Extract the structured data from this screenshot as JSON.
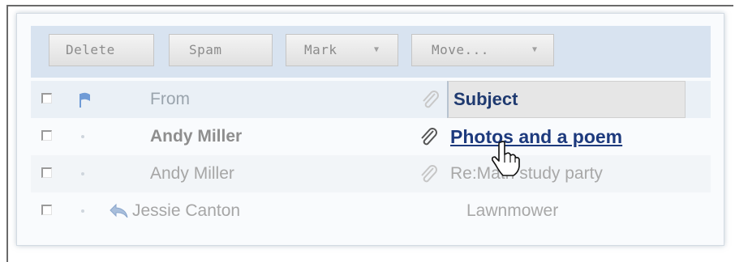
{
  "toolbar": {
    "buttons": [
      {
        "label": "Delete"
      },
      {
        "label": "Spam"
      },
      {
        "label": "Mark",
        "caret": "▼"
      },
      {
        "label": "Move...",
        "caret": "▼"
      }
    ]
  },
  "columns": {
    "from": "From",
    "subject": "Subject"
  },
  "messages": [
    {
      "from": "Andy Miller",
      "subject": "Photos and a poem",
      "unread": true,
      "attachment": true,
      "state": "hovered-link"
    },
    {
      "from": "Andy Miller",
      "subject": "Re:Math study party",
      "unread": false,
      "attachment": true
    },
    {
      "from": "Jessie Canton",
      "subject": "Lawnmower",
      "unread": false,
      "attachment": false,
      "replied": true
    }
  ],
  "icons": [
    "checkbox",
    "flag-icon",
    "paperclip-icon",
    "reply-arrow-icon",
    "hand-pointer-cursor"
  ],
  "colors": {
    "toolbar_bg": "#d8e3f0",
    "link": "#1d3a7d",
    "flag": "#6f9bd6"
  }
}
